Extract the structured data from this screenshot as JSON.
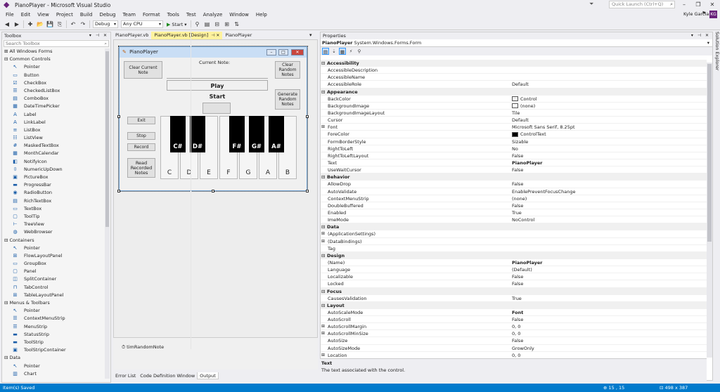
{
  "window": {
    "title": "PianoPlayer - Microsoft Visual Studio",
    "quick_launch_placeholder": "Quick Launch (Ctrl+Q)",
    "user": "Kyle Garcia",
    "user_initials": "KG"
  },
  "menu": [
    "File",
    "Edit",
    "View",
    "Project",
    "Build",
    "Debug",
    "Team",
    "Format",
    "Tools",
    "Test",
    "Analyze",
    "Window",
    "Help"
  ],
  "toolbar": {
    "config": "Debug",
    "platform": "Any CPU",
    "start_label": "Start"
  },
  "toolbox": {
    "title": "Toolbox",
    "search_placeholder": "Search Toolbox",
    "rows": [
      {
        "type": "cat",
        "label": "⊞ All Windows Forms"
      },
      {
        "type": "cat",
        "label": "⊟ Common Controls"
      },
      {
        "type": "item",
        "label": "Pointer",
        "icon": "↖"
      },
      {
        "type": "item",
        "label": "Button",
        "icon": "▭"
      },
      {
        "type": "item",
        "label": "CheckBox",
        "icon": "☑"
      },
      {
        "type": "item",
        "label": "CheckedListBox",
        "icon": "☰"
      },
      {
        "type": "item",
        "label": "ComboBox",
        "icon": "▤"
      },
      {
        "type": "item",
        "label": "DateTimePicker",
        "icon": "▦"
      },
      {
        "type": "item",
        "label": "Label",
        "icon": "A"
      },
      {
        "type": "item",
        "label": "LinkLabel",
        "icon": "A"
      },
      {
        "type": "item",
        "label": "ListBox",
        "icon": "≡"
      },
      {
        "type": "item",
        "label": "ListView",
        "icon": "☷"
      },
      {
        "type": "item",
        "label": "MaskedTextBox",
        "icon": "#"
      },
      {
        "type": "item",
        "label": "MonthCalendar",
        "icon": "▦"
      },
      {
        "type": "item",
        "label": "NotifyIcon",
        "icon": "◧"
      },
      {
        "type": "item",
        "label": "NumericUpDown",
        "icon": "⇳"
      },
      {
        "type": "item",
        "label": "PictureBox",
        "icon": "▣"
      },
      {
        "type": "item",
        "label": "ProgressBar",
        "icon": "▬"
      },
      {
        "type": "item",
        "label": "RadioButton",
        "icon": "◉"
      },
      {
        "type": "item",
        "label": "RichTextBox",
        "icon": "▤"
      },
      {
        "type": "item",
        "label": "TextBox",
        "icon": "▭"
      },
      {
        "type": "item",
        "label": "ToolTip",
        "icon": "▢"
      },
      {
        "type": "item",
        "label": "TreeView",
        "icon": "⊢"
      },
      {
        "type": "item",
        "label": "WebBrowser",
        "icon": "◍"
      },
      {
        "type": "cat",
        "label": "⊟ Containers"
      },
      {
        "type": "item",
        "label": "Pointer",
        "icon": "↖"
      },
      {
        "type": "item",
        "label": "FlowLayoutPanel",
        "icon": "⊞"
      },
      {
        "type": "item",
        "label": "GroupBox",
        "icon": "▭"
      },
      {
        "type": "item",
        "label": "Panel",
        "icon": "▢"
      },
      {
        "type": "item",
        "label": "SplitContainer",
        "icon": "◫"
      },
      {
        "type": "item",
        "label": "TabControl",
        "icon": "⊓"
      },
      {
        "type": "item",
        "label": "TableLayoutPanel",
        "icon": "⊞"
      },
      {
        "type": "cat",
        "label": "⊟ Menus & Toolbars"
      },
      {
        "type": "item",
        "label": "Pointer",
        "icon": "↖"
      },
      {
        "type": "item",
        "label": "ContextMenuStrip",
        "icon": "☰"
      },
      {
        "type": "item",
        "label": "MenuStrip",
        "icon": "☰"
      },
      {
        "type": "item",
        "label": "StatusStrip",
        "icon": "▬"
      },
      {
        "type": "item",
        "label": "ToolStrip",
        "icon": "▬"
      },
      {
        "type": "item",
        "label": "ToolStripContainer",
        "icon": "▣"
      },
      {
        "type": "cat",
        "label": "⊟ Data"
      },
      {
        "type": "item",
        "label": "Pointer",
        "icon": "↖"
      },
      {
        "type": "item",
        "label": "Chart",
        "icon": "▥"
      }
    ]
  },
  "doc_tabs": [
    {
      "label": "PianoPlayer.vb",
      "active": false
    },
    {
      "label": "PianoPlayer.vb [Design]",
      "active": true
    },
    {
      "label": "PianoPlayer",
      "active": false
    }
  ],
  "form": {
    "title": "PianoPlayer",
    "clear_current_note": "Clear Current Note",
    "current_note_label": "Current Note:",
    "clear_random_notes": "Clear Random Notes",
    "play": "Play",
    "start": "Start",
    "generate_random_notes": "Generate Random Notes",
    "exit": "Exit",
    "stop": "Stop",
    "record": "Record",
    "read_recorded_notes": "Read Recorded Notes",
    "white_keys": [
      "C",
      "D",
      "E",
      "F",
      "G",
      "A",
      "B"
    ],
    "black_keys": [
      "C#",
      "D#",
      "F#",
      "G#",
      "A#"
    ]
  },
  "tray": {
    "timer": "timRandomNote"
  },
  "bottom_tabs": [
    "Error List",
    "Code Definition Window",
    "Output"
  ],
  "properties": {
    "title": "Properties",
    "object_name": "PianoPlayer",
    "object_type": "System.Windows.Forms.Form",
    "rows": [
      {
        "t": "cat",
        "n": "Accessibility"
      },
      {
        "t": "p",
        "n": "AccessibleDescription",
        "v": ""
      },
      {
        "t": "p",
        "n": "AccessibleName",
        "v": ""
      },
      {
        "t": "p",
        "n": "AccessibleRole",
        "v": "Default"
      },
      {
        "t": "cat",
        "n": "Appearance"
      },
      {
        "t": "p",
        "n": "BackColor",
        "v": "Control",
        "sw": "#f0f0f0"
      },
      {
        "t": "p",
        "n": "BackgroundImage",
        "v": "(none)",
        "sw": "#ffffff"
      },
      {
        "t": "p",
        "n": "BackgroundImageLayout",
        "v": "Tile"
      },
      {
        "t": "p",
        "n": "Cursor",
        "v": "Default"
      },
      {
        "t": "p",
        "n": "Font",
        "v": "Microsoft Sans Serif, 8.25pt",
        "plus": true
      },
      {
        "t": "p",
        "n": "ForeColor",
        "v": "ControlText",
        "sw": "#000000"
      },
      {
        "t": "p",
        "n": "FormBorderStyle",
        "v": "Sizable"
      },
      {
        "t": "p",
        "n": "RightToLeft",
        "v": "No"
      },
      {
        "t": "p",
        "n": "RightToLeftLayout",
        "v": "False"
      },
      {
        "t": "p",
        "n": "Text",
        "v": "PianoPlayer",
        "b": true
      },
      {
        "t": "p",
        "n": "UseWaitCursor",
        "v": "False"
      },
      {
        "t": "cat",
        "n": "Behavior"
      },
      {
        "t": "p",
        "n": "AllowDrop",
        "v": "False"
      },
      {
        "t": "p",
        "n": "AutoValidate",
        "v": "EnablePreventFocusChange"
      },
      {
        "t": "p",
        "n": "ContextMenuStrip",
        "v": "(none)"
      },
      {
        "t": "p",
        "n": "DoubleBuffered",
        "v": "False"
      },
      {
        "t": "p",
        "n": "Enabled",
        "v": "True"
      },
      {
        "t": "p",
        "n": "ImeMode",
        "v": "NoControl"
      },
      {
        "t": "cat",
        "n": "Data"
      },
      {
        "t": "p",
        "n": "(ApplicationSettings)",
        "v": "",
        "plus": true
      },
      {
        "t": "p",
        "n": "(DataBindings)",
        "v": "",
        "plus": true
      },
      {
        "t": "p",
        "n": "Tag",
        "v": ""
      },
      {
        "t": "cat",
        "n": "Design"
      },
      {
        "t": "p",
        "n": "(Name)",
        "v": "PianoPlayer",
        "b": true
      },
      {
        "t": "p",
        "n": "Language",
        "v": "(Default)"
      },
      {
        "t": "p",
        "n": "Localizable",
        "v": "False"
      },
      {
        "t": "p",
        "n": "Locked",
        "v": "False"
      },
      {
        "t": "cat",
        "n": "Focus"
      },
      {
        "t": "p",
        "n": "CausesValidation",
        "v": "True"
      },
      {
        "t": "cat",
        "n": "Layout"
      },
      {
        "t": "p",
        "n": "AutoScaleMode",
        "v": "Font",
        "b": true
      },
      {
        "t": "p",
        "n": "AutoScroll",
        "v": "False"
      },
      {
        "t": "p",
        "n": "AutoScrollMargin",
        "v": "0, 0",
        "plus": true
      },
      {
        "t": "p",
        "n": "AutoScrollMinSize",
        "v": "0, 0",
        "plus": true
      },
      {
        "t": "p",
        "n": "AutoSize",
        "v": "False"
      },
      {
        "t": "p",
        "n": "AutoSizeMode",
        "v": "GrowOnly"
      },
      {
        "t": "p",
        "n": "Location",
        "v": "0, 0",
        "plus": true
      }
    ],
    "desc_name": "Text",
    "desc_text": "The text associated with the control."
  },
  "solution_explorer": "Solution Explorer",
  "status": {
    "text": "Item(s) Saved",
    "position": "15 , 15",
    "size": "498 x 387"
  }
}
